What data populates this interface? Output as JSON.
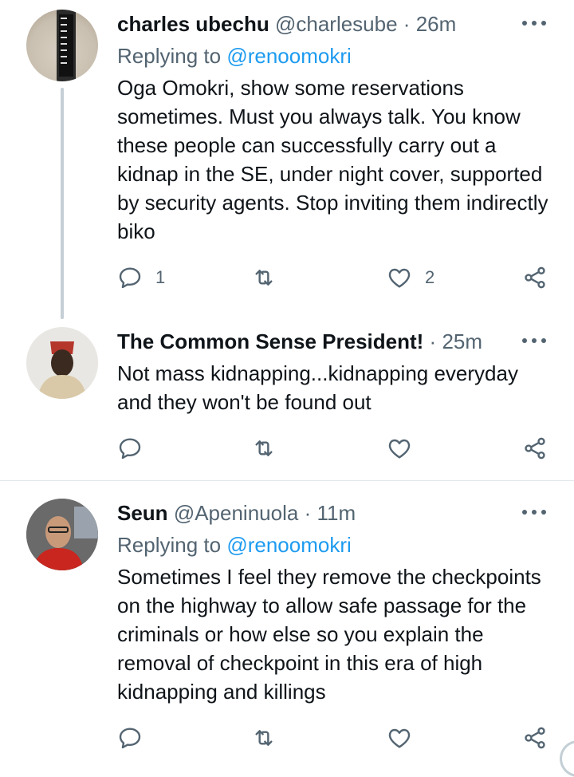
{
  "tweets": [
    {
      "name": "charles ubechu",
      "handle": "@charlesube",
      "dot": "·",
      "time": "26m",
      "replying_label": "Replying to",
      "replying_to": "@renoomokri",
      "text": "Oga Omokri, show some reservations sometimes.  Must you always talk. You know these people can successfully carry out a kidnap in the SE, under  night cover, supported by security agents.  Stop inviting them indirectly biko",
      "reply_count": "1",
      "retweet_count": "",
      "like_count": "2"
    },
    {
      "name": "The Common Sense President!",
      "dot": "·",
      "time": "25m",
      "text": "Not mass kidnapping...kidnapping everyday and they won't be found out",
      "reply_count": "",
      "retweet_count": "",
      "like_count": ""
    },
    {
      "name": "Seun",
      "handle": "@Apeninuola",
      "dot": "·",
      "time": "11m",
      "replying_label": "Replying to",
      "replying_to": "@renoomokri",
      "text": "Sometimes I feel they remove the checkpoints on the highway to allow safe passage for the criminals or how else so you explain the removal of checkpoint in this era of high kidnapping and killings",
      "reply_count": "",
      "retweet_count": "",
      "like_count": ""
    }
  ],
  "colors": {
    "text": "#0f1419",
    "secondary": "#536471",
    "link": "#1d9bf0",
    "divider": "#e1e8ed",
    "thread_line": "#c4cfd6"
  },
  "icons": [
    "reply-icon",
    "retweet-icon",
    "like-icon",
    "share-icon",
    "more-icon"
  ]
}
